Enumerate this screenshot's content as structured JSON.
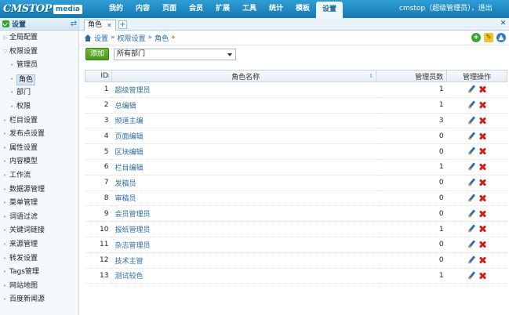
{
  "header": {
    "logo_text": "CMSTOP",
    "logo_badge": "media",
    "nav": [
      "我的",
      "内容",
      "页面",
      "会员",
      "扩展",
      "工具",
      "统计",
      "模板",
      "设置"
    ],
    "active_nav": "设置",
    "user": "cmstop（超级管理员）",
    "logout": "退出"
  },
  "sidebar": {
    "title": "设置",
    "items": [
      {
        "label": "全局配置",
        "type": "group"
      },
      {
        "label": "权限设置",
        "type": "group-open"
      },
      {
        "label": "管理员",
        "type": "sub"
      },
      {
        "label": "角色",
        "type": "sub",
        "selected": true
      },
      {
        "label": "部门",
        "type": "sub"
      },
      {
        "label": "权限",
        "type": "sub"
      },
      {
        "label": "栏目设置",
        "type": "item"
      },
      {
        "label": "发布点设置",
        "type": "item"
      },
      {
        "label": "属性设置",
        "type": "item"
      },
      {
        "label": "内容模型",
        "type": "item"
      },
      {
        "label": "工作流",
        "type": "item"
      },
      {
        "label": "数据源管理",
        "type": "item"
      },
      {
        "label": "菜单管理",
        "type": "item"
      },
      {
        "label": "词语过滤",
        "type": "item"
      },
      {
        "label": "关键词链接",
        "type": "item"
      },
      {
        "label": "来源管理",
        "type": "item"
      },
      {
        "label": "转发设置",
        "type": "item"
      },
      {
        "label": "Tags管理",
        "type": "item"
      },
      {
        "label": "网站地图",
        "type": "item"
      },
      {
        "label": "百度新闻源",
        "type": "item"
      }
    ]
  },
  "tabs": {
    "active_label": "角色"
  },
  "breadcrumb": [
    "设置",
    "权限设置",
    "角色"
  ],
  "toolbar": {
    "add_label": "添加",
    "dept_selected": "所有部门"
  },
  "table": {
    "headers": {
      "id": "ID",
      "name": "角色名称",
      "count": "管理员数",
      "ops": "管理操作"
    },
    "rows": [
      {
        "id": "1",
        "name": "超级管理员",
        "count": "1"
      },
      {
        "id": "2",
        "name": "总编辑",
        "count": "1"
      },
      {
        "id": "3",
        "name": "频道主编",
        "count": "3"
      },
      {
        "id": "4",
        "name": "页面编辑",
        "count": "0"
      },
      {
        "id": "5",
        "name": "区块编辑",
        "count": "0"
      },
      {
        "id": "6",
        "name": "栏目编辑",
        "count": "1"
      },
      {
        "id": "7",
        "name": "发稿员",
        "count": "0"
      },
      {
        "id": "8",
        "name": "审稿员",
        "count": "0"
      },
      {
        "id": "9",
        "name": "会员管理员",
        "count": "0"
      },
      {
        "id": "10",
        "name": "报纸管理员",
        "count": "1"
      },
      {
        "id": "11",
        "name": "杂志管理员",
        "count": "0"
      },
      {
        "id": "12",
        "name": "技术主管",
        "count": "0"
      },
      {
        "id": "13",
        "name": "测试较色",
        "count": "1"
      }
    ]
  },
  "icons": {
    "edit": "pencil-icon",
    "delete": "x-delete-icon",
    "accent": "#1479b3"
  }
}
